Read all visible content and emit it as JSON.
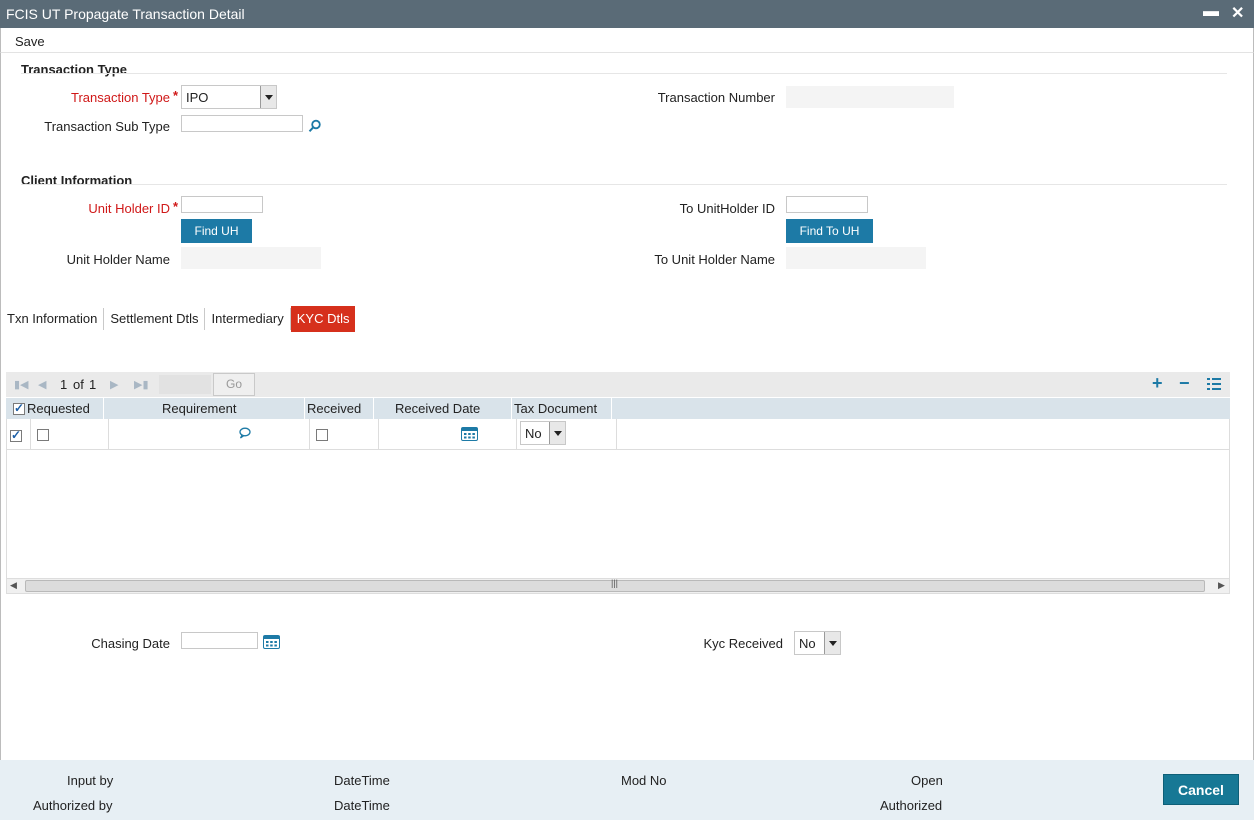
{
  "window": {
    "title": "FCIS UT Propagate Transaction Detail",
    "minimize": "▬",
    "close": "✕"
  },
  "menu": {
    "save": "Save"
  },
  "transaction_type_section": {
    "title": "Transaction Type",
    "type_label": "Transaction Type",
    "type_value": "IPO",
    "sub_type_label": "Transaction Sub Type",
    "sub_type_value": "",
    "number_label": "Transaction Number",
    "number_value": ""
  },
  "client_section": {
    "title": "Client Information",
    "uh_id_label": "Unit Holder ID",
    "uh_id_value": "",
    "find_uh": "Find UH",
    "uh_name_label": "Unit Holder Name",
    "uh_name_value": "",
    "to_uh_id_label": "To UnitHolder ID",
    "to_uh_id_value": "",
    "find_to_uh": "Find To UH",
    "to_uh_name_label": "To Unit Holder Name",
    "to_uh_name_value": ""
  },
  "tabs": [
    {
      "label": "Txn Information",
      "active": false
    },
    {
      "label": "Settlement Dtls",
      "active": false
    },
    {
      "label": "Intermediary",
      "active": false
    },
    {
      "label": "KYC Dtls",
      "active": true
    }
  ],
  "grid": {
    "pager": {
      "current": "1",
      "of": "of",
      "total": "1",
      "go": "Go"
    },
    "columns": [
      "Requested",
      "Requirement",
      "Received",
      "Received Date",
      "Tax Document"
    ],
    "rows": [
      {
        "selected": true,
        "requested": false,
        "requirement": "",
        "received": false,
        "received_date": "",
        "tax_document": "No"
      }
    ]
  },
  "kyc": {
    "chasing_date_label": "Chasing Date",
    "chasing_date_value": "",
    "kyc_received_label": "Kyc Received",
    "kyc_received_value": "No"
  },
  "footer": {
    "input_by": "Input by",
    "authorized_by": "Authorized by",
    "datetime1": "DateTime",
    "datetime2": "DateTime",
    "mod_no": "Mod No",
    "open": "Open",
    "authorized": "Authorized",
    "cancel": "Cancel"
  }
}
